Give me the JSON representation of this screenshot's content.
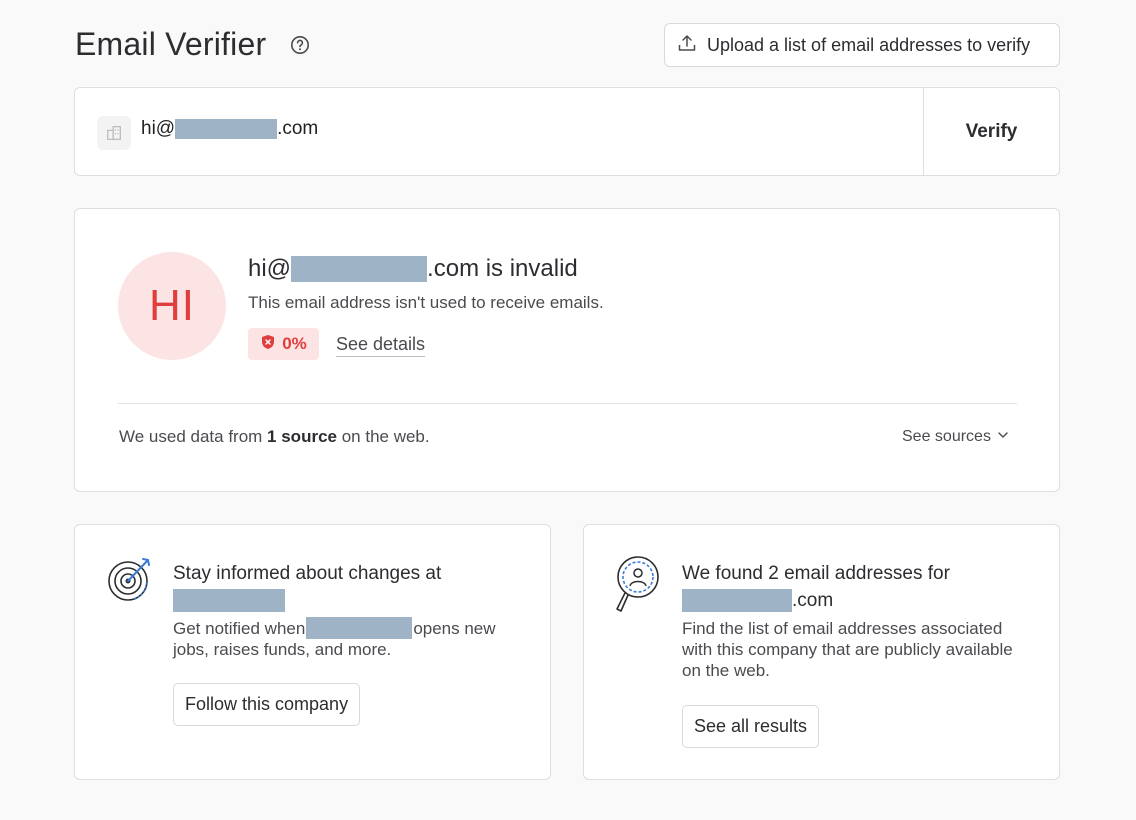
{
  "header": {
    "title": "Email Verifier",
    "upload_label": "Upload a list of email addresses to verify"
  },
  "verify_form": {
    "email_prefix": "hi@",
    "email_suffix": ".com",
    "verify_label": "Verify"
  },
  "result": {
    "avatar_initials": "HI",
    "title_prefix": "hi@",
    "title_suffix": ".com is invalid",
    "description": "This email address isn't used to receive emails.",
    "score": "0%",
    "see_details_label": "See details",
    "sources_prefix": "We used data from ",
    "sources_count": "1 source",
    "sources_suffix": " on the web.",
    "see_sources_label": "See sources",
    "accent_color": "#e03e3e"
  },
  "follow_card": {
    "title": "Stay informed about changes at",
    "body_prefix": "Get notified when",
    "body_suffix": "opens new jobs, raises funds, and more.",
    "button_label": "Follow this company"
  },
  "results_card": {
    "title": "We found 2 email addresses for",
    "title_suffix": ".com",
    "body": "Find the list of email addresses associated with this company that are publicly available on the web.",
    "button_label": "See all results"
  }
}
